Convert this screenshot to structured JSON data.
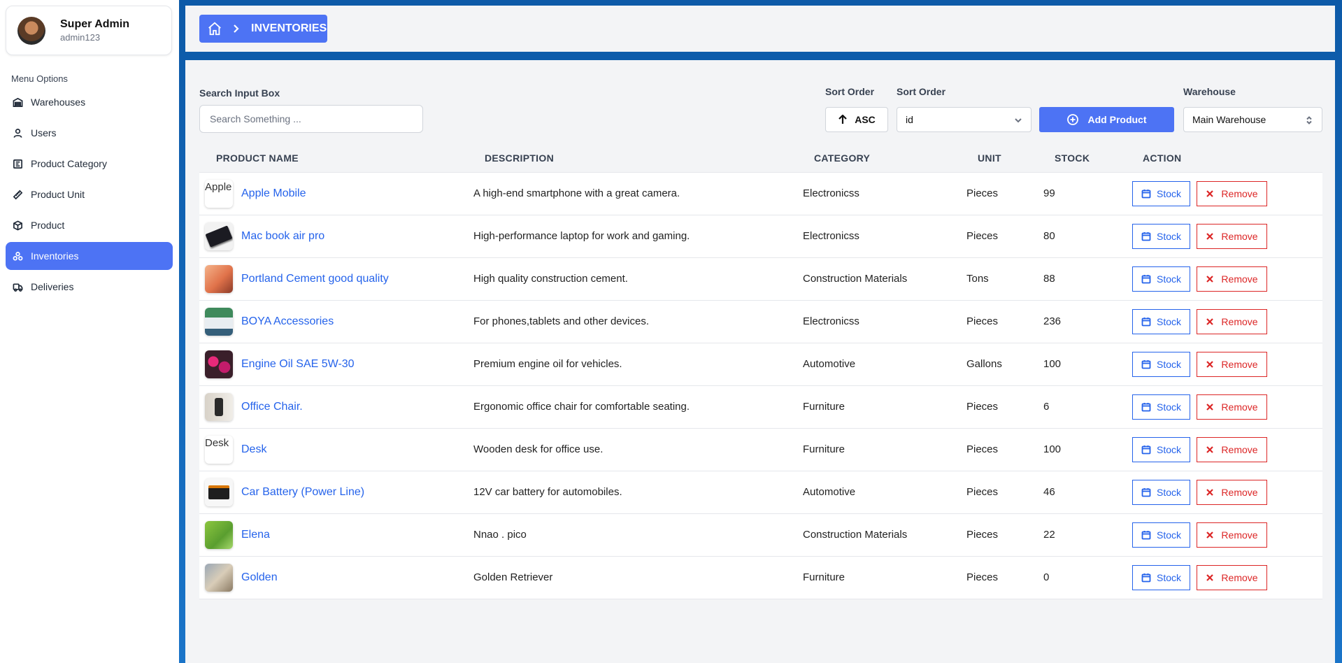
{
  "sidebar": {
    "profile": {
      "name": "Super Admin",
      "username": "admin123"
    },
    "menu_title": "Menu Options",
    "items": [
      {
        "label": "Warehouses",
        "icon": "warehouse-icon",
        "active": false
      },
      {
        "label": "Users",
        "icon": "user-icon",
        "active": false
      },
      {
        "label": "Product Category",
        "icon": "category-icon",
        "active": false
      },
      {
        "label": "Product Unit",
        "icon": "ruler-icon",
        "active": false
      },
      {
        "label": "Product",
        "icon": "box-icon",
        "active": false
      },
      {
        "label": "Inventories",
        "icon": "inventory-icon",
        "active": true
      },
      {
        "label": "Deliveries",
        "icon": "truck-icon",
        "active": false
      }
    ]
  },
  "header": {
    "breadcrumb": "INVENTORIES"
  },
  "filters": {
    "search_label": "Search Input Box",
    "search_placeholder": "Search Something ...",
    "search_value": "",
    "sort_order_label": "Sort Order",
    "sort_direction": "ASC",
    "sort_field_label": "Sort Order",
    "sort_field": "id",
    "add_button": "Add Product",
    "warehouse_label": "Warehouse",
    "warehouse": "Main Warehouse"
  },
  "table": {
    "headers": [
      "PRODUCT NAME",
      "DESCRIPTION",
      "CATEGORY",
      "UNIT",
      "STOCK",
      "ACTION"
    ],
    "stock_label": "Stock",
    "remove_label": "Remove",
    "rows": [
      {
        "name": "Apple Mobile",
        "description": "A high-end smartphone with a great camera.",
        "category": "Electronicss",
        "unit": "Pieces",
        "stock": "99",
        "image_alt": "Apple Mobile",
        "image": "broken"
      },
      {
        "name": "Mac book air pro",
        "description": "High-performance laptop for work and gaming.",
        "category": "Electronicss",
        "unit": "Pieces",
        "stock": "80",
        "image": "laptop"
      },
      {
        "name": "Portland Cement good quality",
        "description": "High quality construction cement.",
        "category": "Construction Materials",
        "unit": "Tons",
        "stock": "88",
        "image": "cosmetics"
      },
      {
        "name": "BOYA Accessories",
        "description": "For phones,tablets and other devices.",
        "category": "Electronicss",
        "unit": "Pieces",
        "stock": "236",
        "image": "accessories"
      },
      {
        "name": "Engine Oil SAE 5W-30",
        "description": "Premium engine oil for vehicles.",
        "category": "Automotive",
        "unit": "Gallons",
        "stock": "100",
        "image": "flowers"
      },
      {
        "name": "Office Chair.",
        "description": "Ergonomic office chair for comfortable seating.",
        "category": "Furniture",
        "unit": "Pieces",
        "stock": "6",
        "image": "chair"
      },
      {
        "name": "Desk",
        "description": "Wooden desk for office use.",
        "category": "Furniture",
        "unit": "Pieces",
        "stock": "100",
        "image_alt": "Desk",
        "image": "broken"
      },
      {
        "name": "Car Battery (Power Line)",
        "description": "12V car battery for automobiles.",
        "category": "Automotive",
        "unit": "Pieces",
        "stock": "46",
        "image": "battery"
      },
      {
        "name": "Elena",
        "description": "Nnao . pico",
        "category": "Construction Materials",
        "unit": "Pieces",
        "stock": "22",
        "image": "leaf"
      },
      {
        "name": "Golden",
        "description": "Golden Retriever",
        "category": "Furniture",
        "unit": "Pieces",
        "stock": "0",
        "image": "dog"
      }
    ]
  },
  "colors": {
    "accent": "#4d73f4",
    "link": "#2563eb",
    "danger": "#dc2626",
    "edge": "#0d5aa8"
  }
}
